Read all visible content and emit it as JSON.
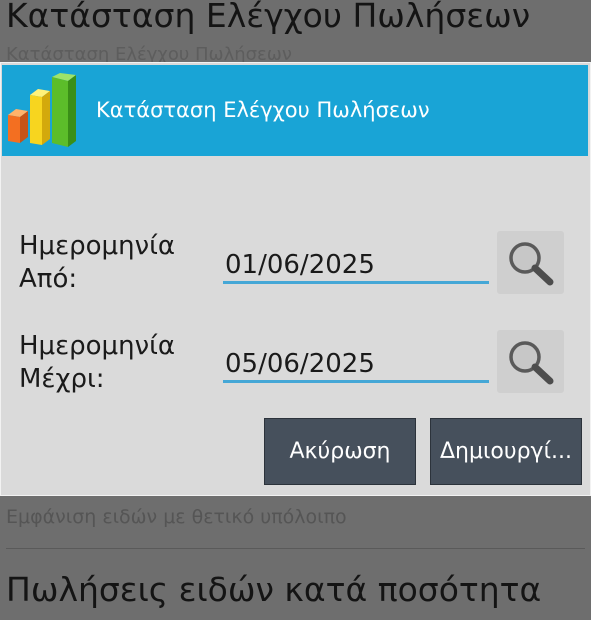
{
  "background": {
    "screen_title": "Κατάσταση Ελέγχου Πωλήσεων",
    "screen_subtitle": "Κατάσταση Ελέγχου Πωλήσεων",
    "item_subtitle": "Εμφάνιση ειδών με θετικό υπόλοιπο",
    "next_item_title": "Πωλήσεις ειδών κατά ποσότητα"
  },
  "dialog": {
    "title": "Κατάσταση Ελέγχου Πωλήσεων",
    "from": {
      "label_line1": "Ημερομηνία",
      "label_line2": "Από:",
      "value": "01/06/2025",
      "search_icon": "magnifier-icon"
    },
    "to": {
      "label_line1": "Ημερομηνία",
      "label_line2": "Μέχρι:",
      "value": "05/06/2025",
      "search_icon": "magnifier-icon"
    },
    "cancel_label": "Ακύρωση",
    "create_label": "Δημιουργί..."
  },
  "colors": {
    "header": "#19a4d6",
    "dialog_bg": "#dadada",
    "button_bg": "#46505c",
    "field_underline": "#45a7d6"
  }
}
